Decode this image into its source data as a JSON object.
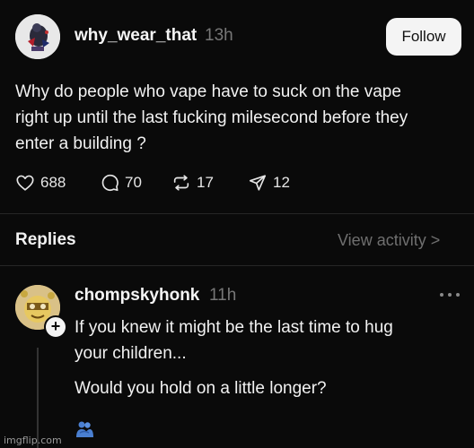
{
  "post": {
    "username": "why_wear_that",
    "time": "13h",
    "follow_label": "Follow",
    "text_lines": [
      "Why do people who vape have to suck on the vape",
      "right up until the last fucking milesecond before they",
      "enter a building ?"
    ],
    "actions": {
      "likes": "688",
      "comments": "70",
      "reposts": "17",
      "shares": "12"
    }
  },
  "replies_section": {
    "title": "Replies",
    "view_activity": "View activity >"
  },
  "reply": {
    "username": "chompskyhonk",
    "time": "11h",
    "text_lines": [
      "If you knew it might be the last time to hug",
      "your children..."
    ],
    "text_line_3": "Would you hold on a little longer?",
    "emoji_icon": "people-hugging-icon"
  },
  "watermark": "imgflip.com",
  "icons": {
    "like": "heart-icon",
    "comment": "comment-icon",
    "repost": "repost-icon",
    "share": "share-icon",
    "more": "more-icon"
  },
  "colors": {
    "background": "#0a0a0a",
    "text": "#f2f2f2",
    "muted": "#777777",
    "follow_bg": "#f4f4f4"
  }
}
